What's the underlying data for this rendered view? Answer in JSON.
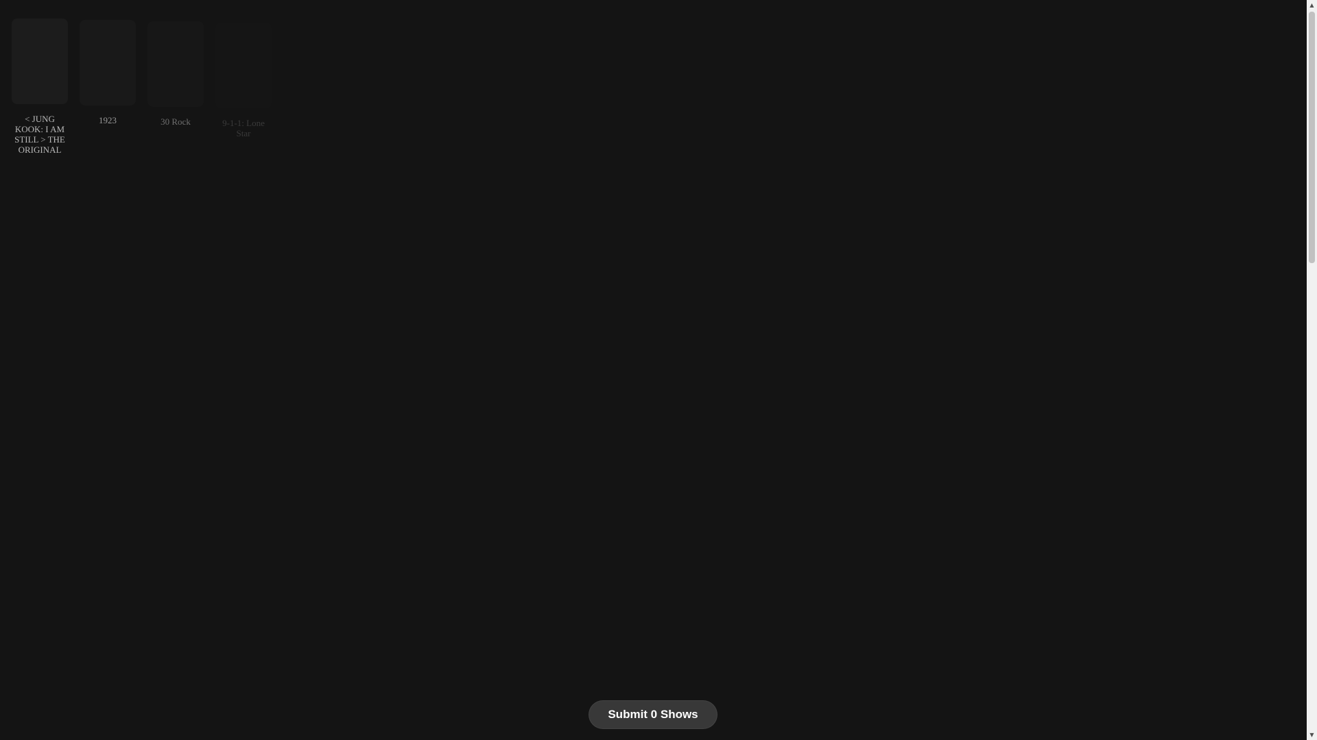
{
  "shows": [
    {
      "title": "< JUNG KOOK: I AM STILL > THE ORIGINAL"
    },
    {
      "title": "1923"
    },
    {
      "title": "30 Rock"
    },
    {
      "title": "9-1-1: Lone Star"
    }
  ],
  "submit_button": {
    "label": "Submit 0 Shows"
  },
  "scrollbar": {
    "position_fraction": 0.0
  }
}
